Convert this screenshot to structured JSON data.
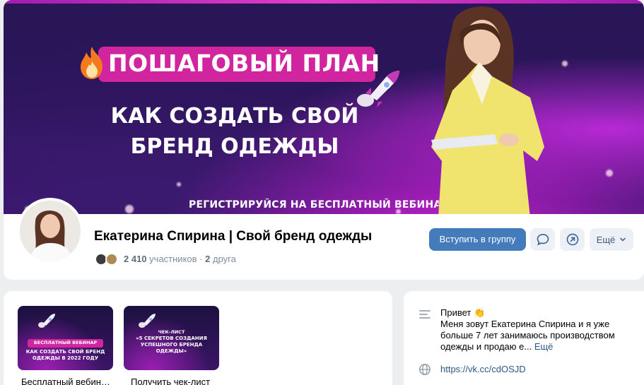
{
  "cover": {
    "headline": "ПОШАГОВЫЙ ПЛАН",
    "subhead_line1": "КАК СОЗДАТЬ СВОЙ",
    "subhead_line2": "БРЕНД ОДЕЖДЫ",
    "register": "РЕГИСТРИРУЙСЯ НА БЕСПЛАТНЫЙ ВЕБИНАР"
  },
  "group": {
    "name": "Екатерина Спирина | Свой бренд одежды",
    "members_count": "2 410",
    "members_label": "участников",
    "separator": "·",
    "friends_count": "2",
    "friends_label": "друга"
  },
  "actions": {
    "join": "Вступить в группу",
    "more": "Ещё",
    "message_icon": "message-icon",
    "share_icon": "share-icon"
  },
  "tiles": [
    {
      "pill": "БЕСПЛАТНЫЙ ВЕБИНАР",
      "line1": "КАК СОЗДАТЬ СВОЙ БРЕНД",
      "line2": "ОДЕЖДЫ В 2022 ГОДУ",
      "caption": "Бесплатный вебин…"
    },
    {
      "line0": "ЧЕК-ЛИСТ",
      "line1": "«5 СЕКРЕТОВ СОЗДАНИЯ",
      "line2": "УСПЕШНОГО БРЕНДА ОДЕЖДЫ»",
      "caption": "Получить чек-лист"
    }
  ],
  "info": {
    "greeting": "Привет 👏",
    "about": "Меня зовут Екатерина Спирина и я уже больше 7 лет занимаюсь производством одежды и продаю е...",
    "about_more": "Ещё",
    "link": "https://vk.cc/cdOSJD"
  },
  "colors": {
    "accent": "#447bba",
    "pink": "#d0259f",
    "page_bg": "#edeef0"
  }
}
